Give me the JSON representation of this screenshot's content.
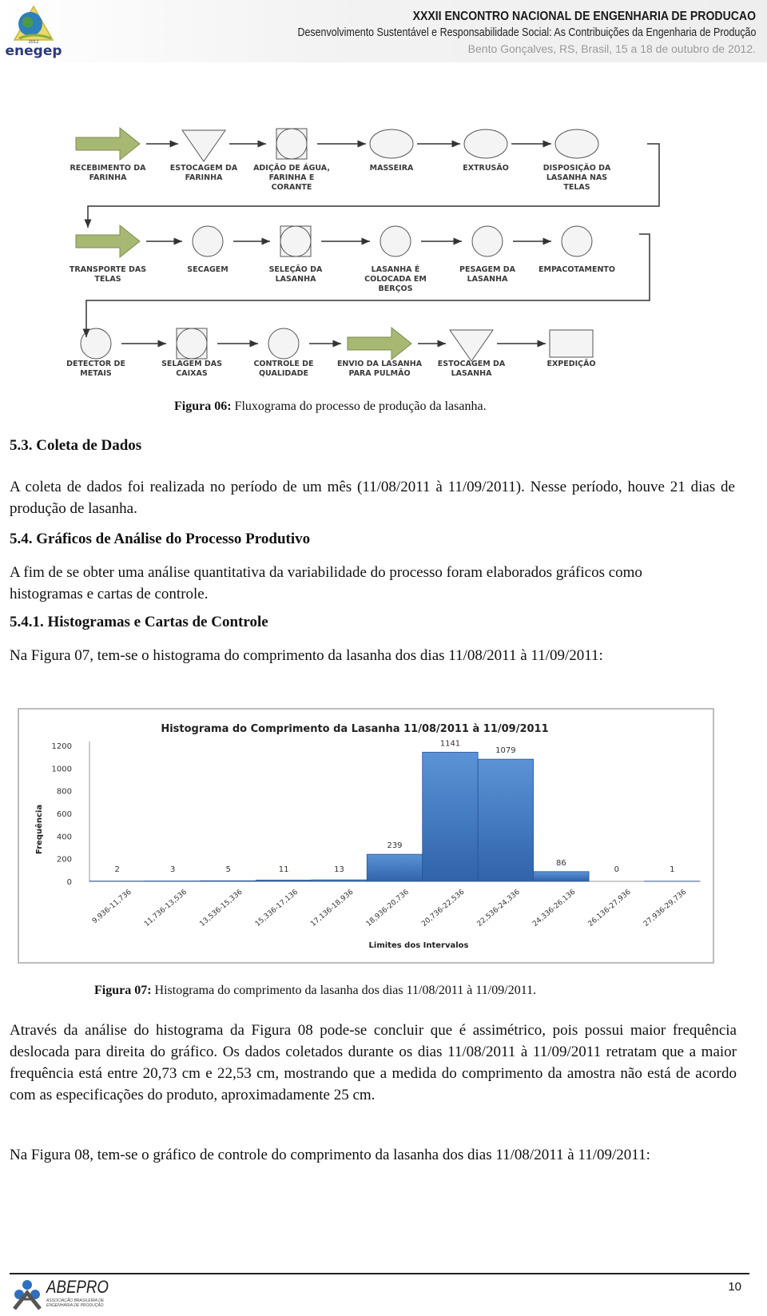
{
  "header": {
    "title": "XXXII ENCONTRO NACIONAL DE ENGENHARIA DE PRODUCAO",
    "subtitle": "Desenvolvimento Sustentável e Responsabilidade Social: As Contribuições da Engenharia de Produção",
    "location_date": "Bento Gonçalves, RS, Brasil, 15 a 18 de outubro de 2012.",
    "logo_text": "enegep",
    "logo_year": "2012"
  },
  "flowchart": {
    "row1": [
      {
        "label": "RECEBIMENTO DA FARINHA",
        "shape": "arrow"
      },
      {
        "label": "ESTOCAGEM DA FARINHA",
        "shape": "triangle"
      },
      {
        "label": "ADIÇÃO DE ÁGUA, FARINHA E CORANTE",
        "shape": "circle-in-square"
      },
      {
        "label": "MASSEIRA",
        "shape": "circle"
      },
      {
        "label": "EXTRUSÃO",
        "shape": "circle"
      },
      {
        "label": "DISPOSIÇÃO DA LASANHA NAS TELAS",
        "shape": "circle"
      }
    ],
    "row2": [
      {
        "label": "TRANSPORTE DAS TELAS",
        "shape": "arrow"
      },
      {
        "label": "SECAGEM",
        "shape": "circle"
      },
      {
        "label": "SELEÇÃO DA LASANHA",
        "shape": "circle-in-square"
      },
      {
        "label": "LASANHA É COLOCADA EM BERÇOS",
        "shape": "circle"
      },
      {
        "label": "PESAGEM DA LASANHA",
        "shape": "circle"
      },
      {
        "label": "EMPACOTAMENTO",
        "shape": "circle"
      }
    ],
    "row3": [
      {
        "label": "DETECTOR DE METAIS",
        "shape": "circle"
      },
      {
        "label": "SELAGEM DAS CAIXAS",
        "shape": "circle-in-square"
      },
      {
        "label": "CONTROLE DE QUALIDADE",
        "shape": "circle"
      },
      {
        "label": "ENVIO DA LASANHA PARA PULMÃO",
        "shape": "arrow"
      },
      {
        "label": "ESTOCAGEM DA LASANHA",
        "shape": "triangle"
      },
      {
        "label": "EXPEDIÇÃO",
        "shape": "rectangle"
      }
    ],
    "colors": {
      "arrow_fill": "#a6b872",
      "arrow_stroke": "#7d8c4e",
      "shape_fill": "#f4f4f4",
      "shape_stroke": "#555555"
    }
  },
  "fig06_caption": {
    "label": "Figura 06:",
    "text": " Fluxograma do processo de produção da lasanha."
  },
  "sec53": {
    "heading": "5.3. Coleta de Dados",
    "para": "A coleta de dados foi realizada no período de um mês (11/08/2011 à 11/09/2011). Nesse período, houve 21 dias de produção de lasanha."
  },
  "sec54": {
    "heading": "5.4. Gráficos de Análise do Processo Produtivo",
    "para": "A fim de se obter uma análise quantitativa da variabilidade do processo foram elaborados gráficos como histogramas e cartas de controle."
  },
  "sec541": {
    "heading": "5.4.1. Histogramas e Cartas de Controle",
    "para": "Na Figura 07, tem-se o histograma do comprimento da lasanha dos dias 11/08/2011 à 11/09/2011:"
  },
  "chart_data": {
    "type": "bar",
    "title": "Histograma do Comprimento da Lasanha 11/08/2011 à 11/09/2011",
    "xlabel": "Limites dos Intervalos",
    "ylabel": "Frequência",
    "ylim": [
      0,
      1200
    ],
    "yticks": [
      0,
      200,
      400,
      600,
      800,
      1000,
      1200
    ],
    "grid": false,
    "legend": "none",
    "bar_color": "#3a74c0",
    "categories": [
      "9,936-11,736",
      "11,736-13,536",
      "13,536-15,336",
      "15,336-17,136",
      "17,136-18,936",
      "18,936-20,736",
      "20,736-22,536",
      "22,536-24,336",
      "24,336-26,136",
      "26,136-27,936",
      "27,936-29,736"
    ],
    "values": [
      2,
      3,
      5,
      11,
      13,
      239,
      1141,
      1079,
      86,
      0,
      1
    ]
  },
  "fig07_caption": {
    "label": "Figura 07:",
    "text": " Histograma do comprimento da lasanha dos dias 11/08/2011 à 11/09/2011."
  },
  "analysis_para": "Através da análise do histograma da Figura 08 pode-se concluir que é assimétrico, pois possui maior frequência deslocada para direita do gráfico. Os dados coletados durante os dias 11/08/2011 à 11/09/2011 retratam que a maior frequência está entre 20,73 cm e 22,53 cm, mostrando que a medida do comprimento da amostra não está de acordo com as especificações do produto, aproximadamente 25 cm.",
  "fig08_intro": "Na Figura 08, tem-se o gráfico de controle do comprimento da lasanha dos dias 11/08/2011 à 11/09/2011:",
  "footer": {
    "logo_text": "ABEPRO",
    "logo_sub": "ASSOCIAÇÃO BRASILEIRA DE ENGENHARIA DE PRODUÇÃO",
    "page_number": "10"
  }
}
